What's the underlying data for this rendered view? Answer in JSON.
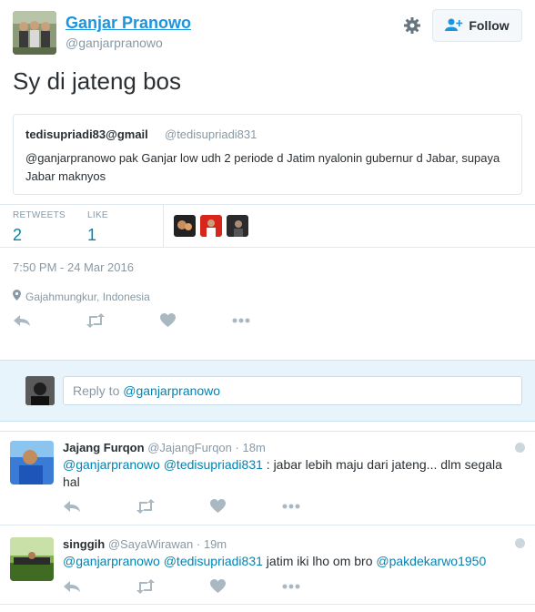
{
  "author": {
    "name": "Ganjar Pranowo",
    "handle": "@ganjarpranowo"
  },
  "follow_label": "Follow",
  "tweet_text": "Sy di jateng bos",
  "quoted": {
    "name": "tedisupriadi83@gmail",
    "handle": "@tedisupriadi831",
    "text": "@ganjarpranowo  pak Ganjar low udh 2 periode d Jatim nyalonin gubernur d Jabar, supaya Jabar maknyos"
  },
  "stats": {
    "retweets_label": "RETWEETS",
    "retweets": "2",
    "likes_label": "LIKE",
    "likes": "1"
  },
  "timestamp": "7:50 PM - 24 Mar 2016",
  "location": "Gajahmungkur, Indonesia",
  "reply_box": {
    "prefix": "Reply to ",
    "mention": "@ganjarpranowo"
  },
  "replies": [
    {
      "name": "Jajang Furqon",
      "handle": "@JajangFurqon",
      "time": "18m",
      "mentions": "@ganjarpranowo @tedisupriadi831",
      "text": " : jabar lebih maju dari jateng... dlm segala hal"
    },
    {
      "name": "singgih",
      "handle": "@SayaWirawan",
      "time": "19m",
      "mentions": "@ganjarpranowo @tedisupriadi831",
      "text": " jatim iki lho om bro ",
      "mention2": "@pakdekarwo1950"
    }
  ],
  "icons": [
    "gear-icon",
    "add-user-icon",
    "location-pin-icon",
    "reply-icon",
    "retweet-icon",
    "heart-icon",
    "more-icon"
  ],
  "colors": {
    "link": "#0084b4",
    "name_link": "#1b95e0",
    "muted": "#8899a6",
    "reply_bg": "#e8f4fb"
  }
}
